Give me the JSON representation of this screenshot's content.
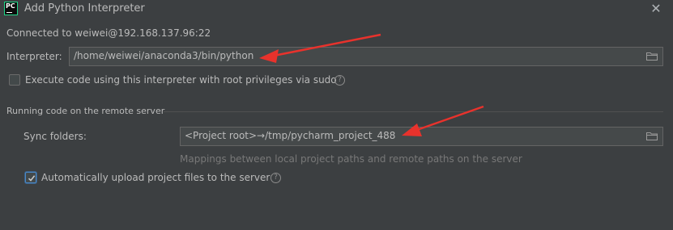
{
  "window": {
    "title": "Add Python Interpreter",
    "app_icon_text": "PC"
  },
  "connection": {
    "text": "Connected to weiwei@192.168.137.96:22"
  },
  "interpreter": {
    "label": "Interpreter:",
    "value": "/home/weiwei/anaconda3/bin/python"
  },
  "sudo": {
    "label": "Execute code using this interpreter with root privileges via sudo",
    "checked": false
  },
  "remote_section": {
    "title": "Running code on the remote server",
    "sync_label": "Sync folders:",
    "sync_value": "<Project root>→/tmp/pycharm_project_488",
    "sync_hint": "Mappings between local project paths and remote paths on the server",
    "auto_upload_label": "Automatically upload project files to the server",
    "auto_upload_checked": true
  },
  "icons": {
    "close": "close-icon",
    "folder": "folder-icon",
    "help": "help-icon",
    "annotation_arrow": "red-arrow"
  },
  "colors": {
    "background": "#3c3f41",
    "field_background": "#45494a",
    "text": "#bbbbbb",
    "hint_text": "#787878",
    "arrow": "#e8322c",
    "checkbox_accent": "#4a88c7"
  }
}
